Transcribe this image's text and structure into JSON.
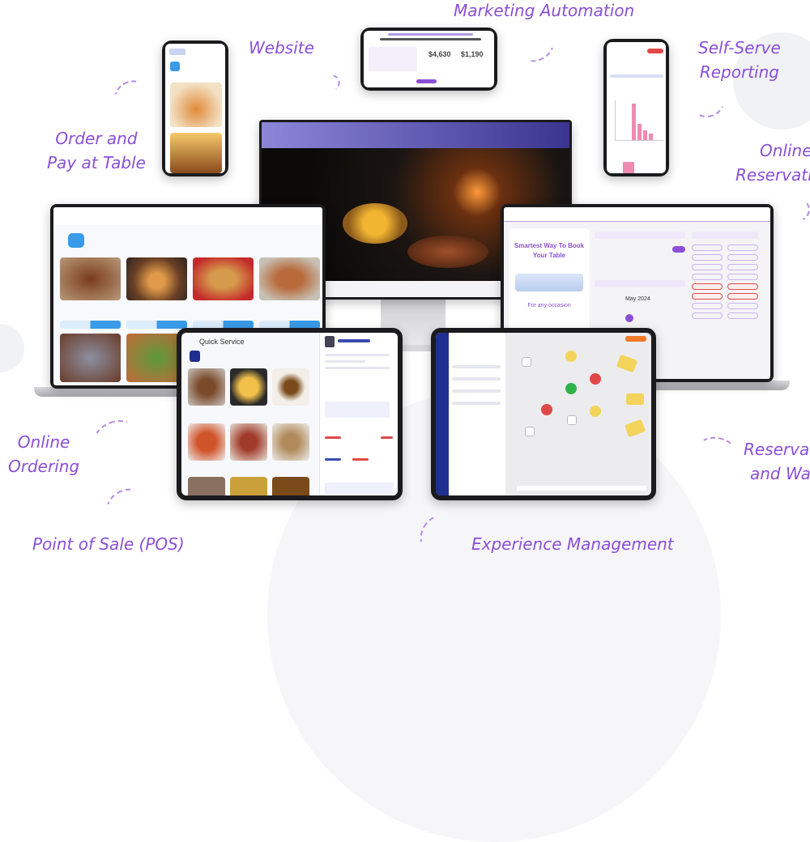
{
  "labels": {
    "marketing": "Marketing Automation",
    "website": "Website",
    "reporting": [
      "Self-Serve",
      "Reporting"
    ],
    "order_pay": [
      "Order and",
      "Pay at Table"
    ],
    "online_res": [
      "Online",
      "Reservati"
    ],
    "online_ordering": [
      "Online",
      "Ordering"
    ],
    "reserva": [
      "Reserva",
      "and Wa"
    ],
    "pos": "Point of Sale (POS)",
    "experience": "Experience Management"
  },
  "reservation_screen": {
    "headline": "Smartest Way To Book Your Table",
    "tagline": "For any occasion",
    "month": "May 2024"
  },
  "pos_screen": {
    "title": "Quick Service"
  },
  "colors": {
    "accent": "#8a4fd6",
    "brand_blue": "#3a9be8",
    "pos_navy": "#1f2f8f",
    "alert_red": "#e04848",
    "table_yellow": "#f3d35a"
  }
}
